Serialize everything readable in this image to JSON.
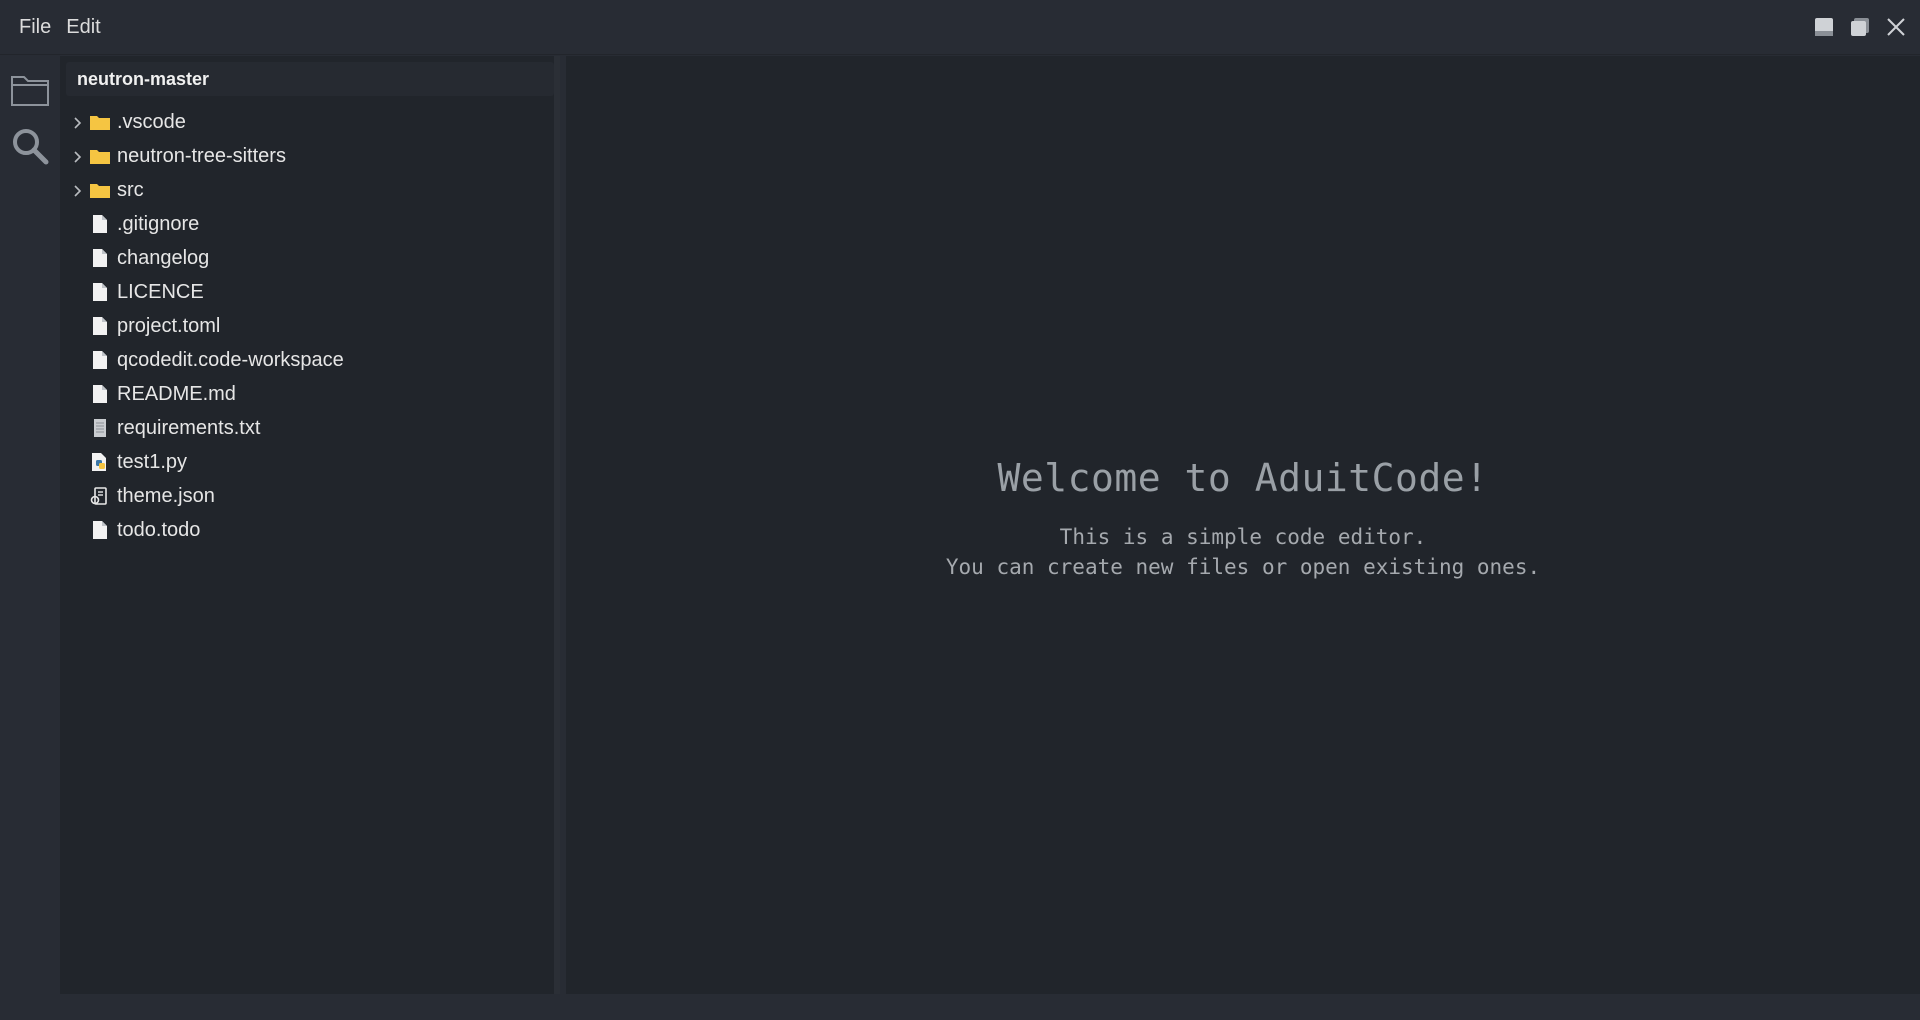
{
  "menu": {
    "file_label": "File",
    "edit_label": "Edit"
  },
  "window_controls": {
    "minimize_icon": "minimize-icon",
    "maximize_icon": "maximize-icon",
    "close_icon": "close-icon"
  },
  "activity_bar": {
    "explorer_icon": "folder-icon",
    "search_icon": "search-icon"
  },
  "sidebar": {
    "title": "neutron-master",
    "items": [
      {
        "label": ".vscode",
        "type": "folder"
      },
      {
        "label": "neutron-tree-sitters",
        "type": "folder"
      },
      {
        "label": "src",
        "type": "folder"
      },
      {
        "label": ".gitignore",
        "type": "file"
      },
      {
        "label": "changelog",
        "type": "file"
      },
      {
        "label": "LICENCE",
        "type": "file"
      },
      {
        "label": "project.toml",
        "type": "file"
      },
      {
        "label": "qcodedit.code-workspace",
        "type": "file"
      },
      {
        "label": "README.md",
        "type": "file"
      },
      {
        "label": "requirements.txt",
        "type": "text-file"
      },
      {
        "label": "test1.py",
        "type": "python-file"
      },
      {
        "label": "theme.json",
        "type": "json-file"
      },
      {
        "label": "todo.todo",
        "type": "file"
      }
    ]
  },
  "editor": {
    "welcome_title": "Welcome to AduitCode!",
    "welcome_line1": "This is a simple code editor.",
    "welcome_line2": "You can create new files or open existing ones."
  },
  "colors": {
    "background": "#282c34",
    "panel": "#21252b",
    "folder": "#f5c542",
    "text": "#e6e6e6",
    "muted": "#9aa0a6"
  }
}
